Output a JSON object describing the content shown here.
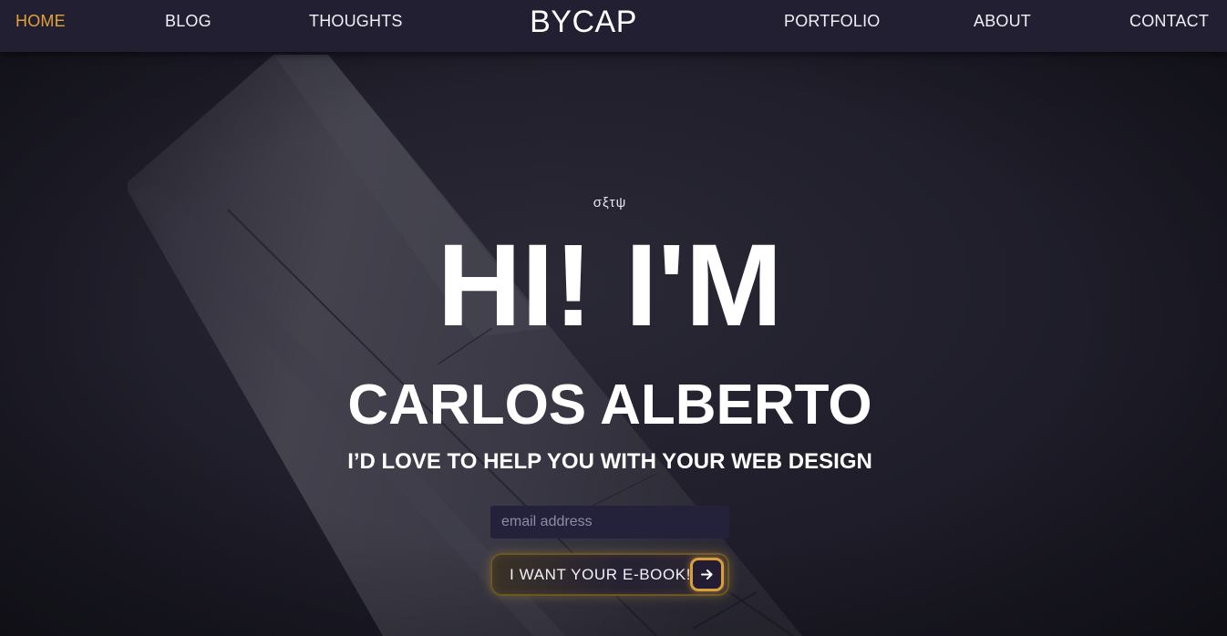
{
  "colors": {
    "nav_background": "#221f32",
    "nav_active": "#e2a336",
    "accent": "#d8a03c",
    "text": "#ffffff"
  },
  "nav": {
    "left_links": [
      {
        "label": "HOME",
        "active": true
      },
      {
        "label": "BLOG",
        "active": false
      },
      {
        "label": "THOUGHTS",
        "active": false
      }
    ],
    "brand": "BYCAP",
    "right_links": [
      {
        "label": "PORTFOLIO",
        "active": false
      },
      {
        "label": "ABOUT",
        "active": false
      },
      {
        "label": "CONTACT",
        "active": false
      }
    ]
  },
  "hero": {
    "eyebrow": "σξτψ",
    "greeting": "HI! I'M",
    "name": "CARLOS ALBERTO",
    "tagline": "I’D LOVE TO HELP YOU WITH YOUR WEB DESIGN",
    "email_placeholder": "email address",
    "email_value": "",
    "cta_label": "I WANT YOUR E-BOOK!",
    "cta_icon": "arrow-right-icon"
  }
}
